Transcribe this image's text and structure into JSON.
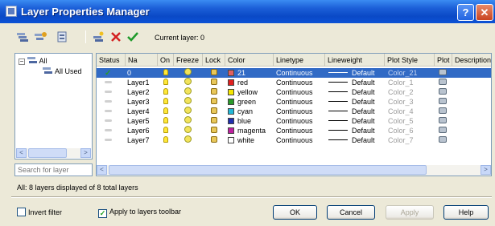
{
  "window": {
    "title": "Layer Properties Manager",
    "help_label": "?",
    "close_label": "✕"
  },
  "toolbar": {
    "icons": [
      "new-property-filter-icon",
      "new-group-filter-icon",
      "layer-states-manager-icon",
      "new-layer-icon",
      "delete-layer-icon",
      "set-current-icon"
    ],
    "current_layer": "Current layer: 0"
  },
  "tree": {
    "root": "All",
    "child": "All Used",
    "scroll_left": "<",
    "scroll_right": ">"
  },
  "search": {
    "placeholder": "Search for layer"
  },
  "grid": {
    "headers": [
      "Status",
      "Na",
      "On",
      "Freeze",
      "Lock",
      "Color",
      "Linetype",
      "Lineweight",
      "Plot Style",
      "Plot",
      "Description"
    ],
    "rows": [
      {
        "name": "0",
        "color_name": "21",
        "swatch": "#e06060",
        "linetype": "Continuous",
        "lineweight": "Default",
        "plot_style": "Color_21",
        "selected": true
      },
      {
        "name": "Layer1",
        "color_name": "red",
        "swatch": "#e02020",
        "linetype": "Continuous",
        "lineweight": "Default",
        "plot_style": "Color_1"
      },
      {
        "name": "Layer2",
        "color_name": "yellow",
        "swatch": "#f5e600",
        "linetype": "Continuous",
        "lineweight": "Default",
        "plot_style": "Color_2"
      },
      {
        "name": "Layer3",
        "color_name": "green",
        "swatch": "#2a9a2a",
        "linetype": "Continuous",
        "lineweight": "Default",
        "plot_style": "Color_3"
      },
      {
        "name": "Layer4",
        "color_name": "cyan",
        "swatch": "#22b8d8",
        "linetype": "Continuous",
        "lineweight": "Default",
        "plot_style": "Color_4"
      },
      {
        "name": "Layer5",
        "color_name": "blue",
        "swatch": "#2030b0",
        "linetype": "Continuous",
        "lineweight": "Default",
        "plot_style": "Color_5"
      },
      {
        "name": "Layer6",
        "color_name": "magenta",
        "swatch": "#c020a0",
        "linetype": "Continuous",
        "lineweight": "Default",
        "plot_style": "Color_6"
      },
      {
        "name": "Layer7",
        "color_name": "white",
        "swatch": "#ffffff",
        "linetype": "Continuous",
        "lineweight": "Default",
        "plot_style": "Color_7"
      }
    ],
    "scroll_left": "<",
    "scroll_right": ">"
  },
  "status_text": "All: 8 layers displayed of 8 total layers",
  "footer": {
    "invert_filter": {
      "label": "Invert filter",
      "checked": false
    },
    "apply_toolbar": {
      "label": "Apply to layers toolbar",
      "checked": true
    },
    "ok": "OK",
    "cancel": "Cancel",
    "apply": "Apply",
    "help": "Help"
  }
}
